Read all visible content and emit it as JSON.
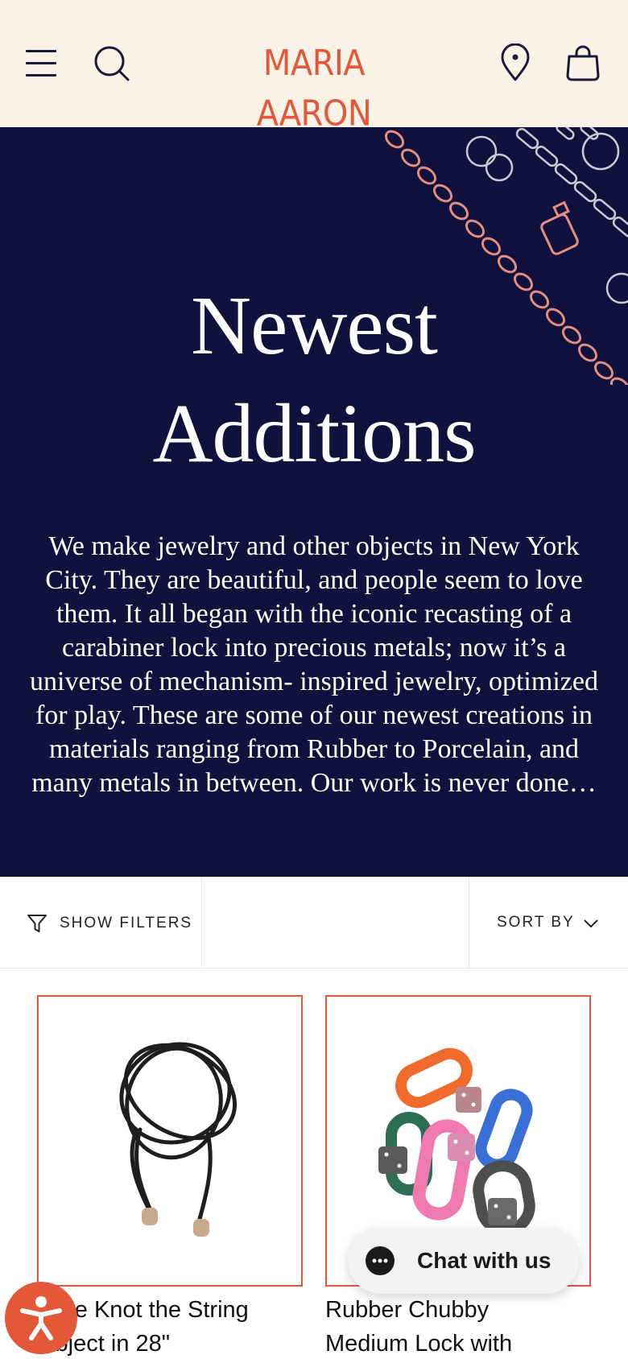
{
  "colors": {
    "header_bg": "#f8f3e6",
    "hero_bg": "#11113d",
    "brand": "#e4583a",
    "logo_gradient": [
      "#e4583a",
      "#b86a88"
    ]
  },
  "header": {
    "logo_text": "MARIA AARON",
    "icons": [
      "menu-icon",
      "search-icon",
      "location-pin-icon",
      "shopping-bag-icon"
    ]
  },
  "hero": {
    "title_line1": "Newest",
    "title_line2": "Additions",
    "description": "We make jewelry and other objects in New York City. They are beautiful, and people seem to love them. It all began with the iconic recasting of a carabiner lock into precious metals; now it’s a universe of mechanism- inspired jewelry, optimized for play. These are some of our newest creations in materials ranging from Rubber to Porcelain, and many metals in between. Our work is never done…"
  },
  "toolbar": {
    "filters_label": "SHOW FILTERS",
    "sort_label": "SORT BY"
  },
  "products": [
    {
      "name_line1": "Love Knot the String",
      "name_line2": "Object in 28\""
    },
    {
      "name_line1": "Rubber Chubby",
      "name_line2": "Medium Lock with"
    }
  ],
  "chat": {
    "label": "Chat with us"
  }
}
